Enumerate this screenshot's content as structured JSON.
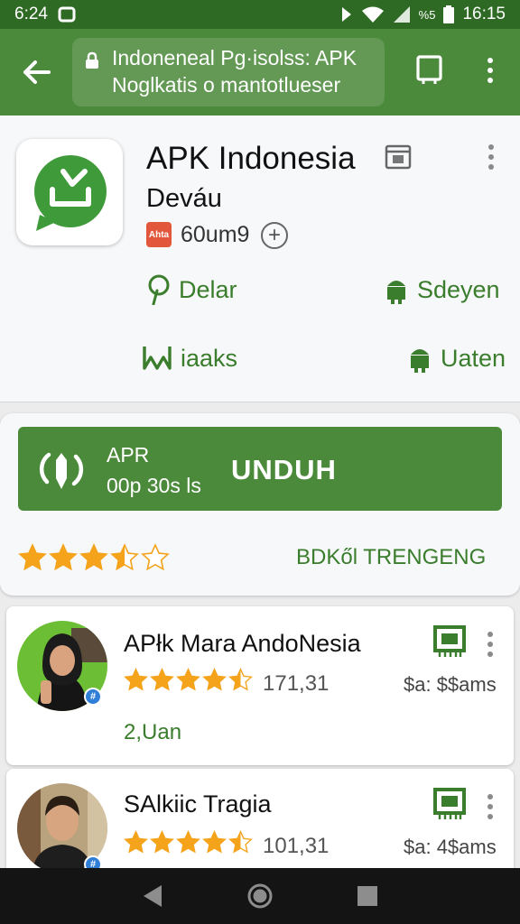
{
  "status_bar": {
    "left_time": "6:24",
    "battery_percent": "%5",
    "clock": "16:15"
  },
  "app_bar": {
    "url_line1": "Indoneneal Pg·isolss: APK",
    "url_line2": "Noglkatis o mantotlueser"
  },
  "app": {
    "title": "APK Indonesia",
    "developer": "Deváu",
    "rating_badge": "Ahta",
    "size": "60um9",
    "plus_label": "+"
  },
  "actions": [
    {
      "label": "Delar",
      "icon": "pin-icon"
    },
    {
      "label": "Sdeyen",
      "icon": "android-icon"
    },
    {
      "label": "iaaks",
      "icon": "wave-icon"
    },
    {
      "label": "Uaten",
      "icon": "android-icon"
    }
  ],
  "download": {
    "line1": "APR",
    "line2": "00p 30s ls",
    "label": "UNDUH",
    "rating": 3.5,
    "trending_label": "BDKől TRENGENG"
  },
  "list": [
    {
      "name": "APłk Mara AndoNesia",
      "score": "171,31",
      "price": "$a: $$ams",
      "extra": "2,Uan",
      "rating": 4.5
    },
    {
      "name": "SAlkiic Tragia",
      "score": "101,31",
      "price": "$a: 4$ams",
      "extra": "",
      "rating": 4.5
    }
  ],
  "colors": {
    "primary": "#4c8a3b",
    "status_bar": "#2f6a24",
    "accent_text": "#3a7d2c",
    "star": "#f4a31b",
    "nav_bar": "#141414"
  }
}
